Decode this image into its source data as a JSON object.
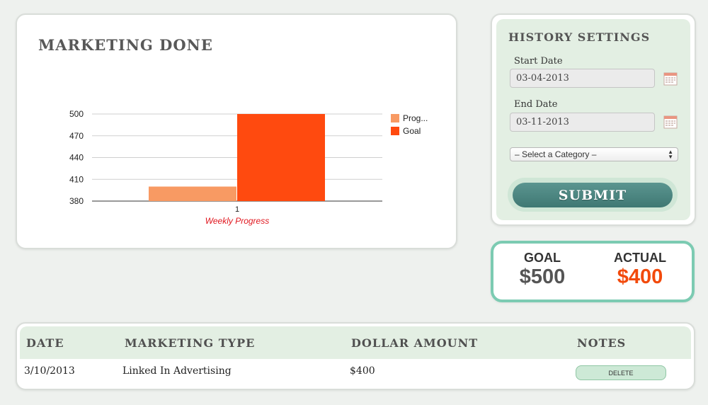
{
  "chart_card": {
    "title": "MARKETING DONE"
  },
  "chart_data": {
    "type": "bar",
    "categories": [
      "1"
    ],
    "series": [
      {
        "name": "Prog...",
        "values": [
          400
        ],
        "color": "#f89a63"
      },
      {
        "name": "Goal",
        "values": [
          500
        ],
        "color": "#ff4a0f"
      }
    ],
    "xlabel": "Weekly Progress",
    "ylim": [
      380,
      500
    ],
    "yticks": [
      500,
      470,
      440,
      410,
      380
    ],
    "grid": true,
    "legend": "right"
  },
  "history": {
    "title": "HISTORY SETTINGS",
    "start_label": "Start Date",
    "start_value": "03-04-2013",
    "end_label": "End Date",
    "end_value": "03-11-2013",
    "category_value": "– Select a Category –",
    "submit_label": "SUBMIT",
    "calendar_icon": "calendar-icon"
  },
  "summary": {
    "goal_label": "GOAL",
    "goal_value": "$500",
    "actual_label": "ACTUAL",
    "actual_value": "$400",
    "actual_color": "#f24a0c"
  },
  "table": {
    "headers": [
      "DATE",
      "MARKETING TYPE",
      "DOLLAR AMOUNT",
      "NOTES"
    ],
    "rows": [
      {
        "date": "3/10/2013",
        "type": "Linked In Advertising",
        "amount": "$400",
        "action": "DELETE"
      }
    ]
  }
}
